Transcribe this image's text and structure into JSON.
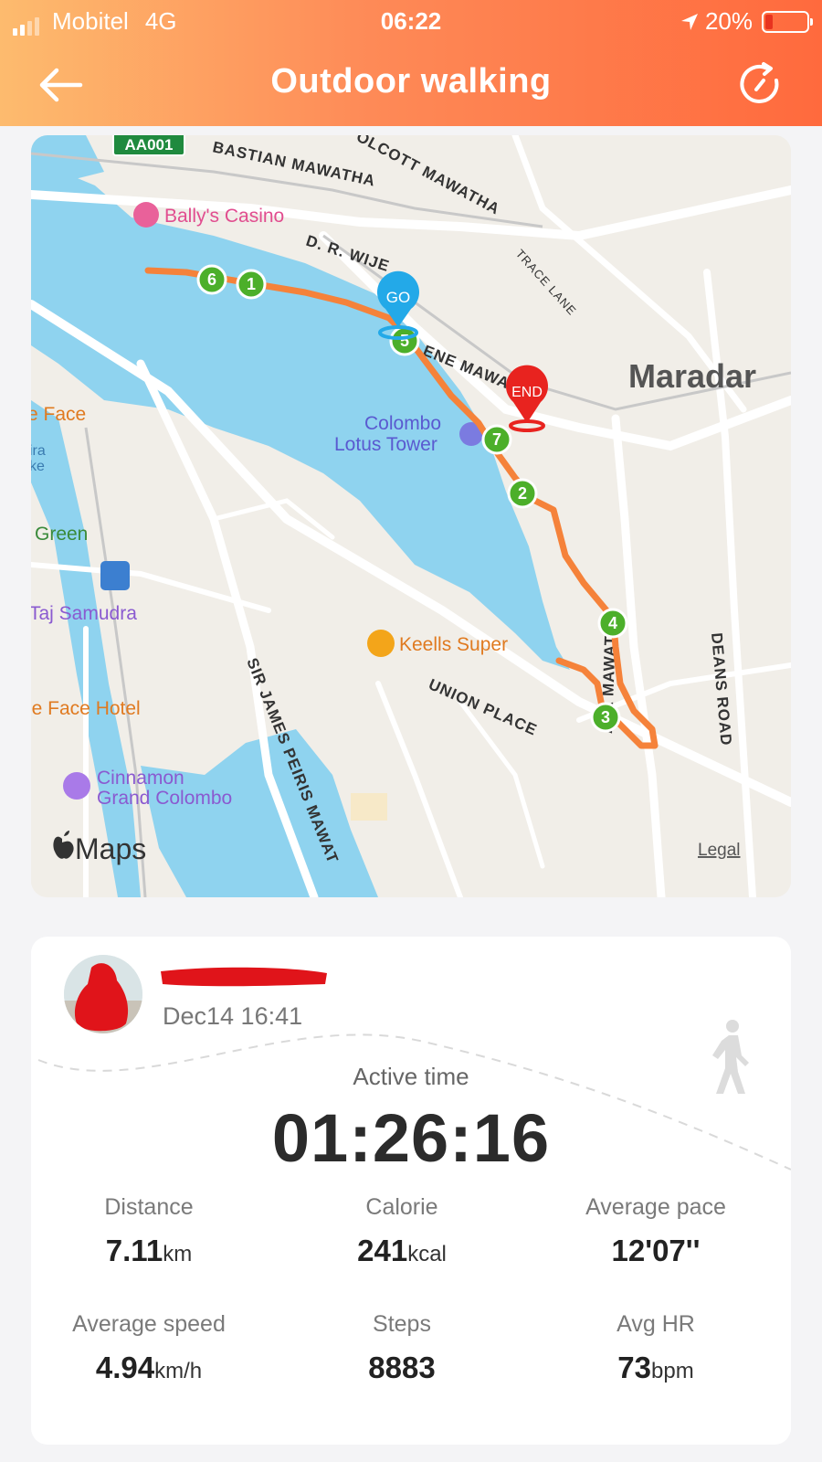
{
  "status_bar": {
    "carrier": "Mobitel",
    "network": "4G",
    "time": "06:22",
    "battery": "20%"
  },
  "header": {
    "title": "Outdoor walking",
    "back_icon": "arrow-left-icon",
    "action_icon": "refresh-icon"
  },
  "map": {
    "streets": [
      "BASTIAN MAWATHA",
      "OLCOTT MAWATHA",
      "D. R. WIJE",
      "TRACE LANE",
      "ENE MAWA",
      "UNION PLACE",
      "SIR JAMES PEIRIS MAWAT",
      "DEANS ROAD",
      "AYA MAWATHA"
    ],
    "highway_shield": "AA001",
    "places": {
      "bally": "Bally's Casino",
      "lotus_1": "Colombo",
      "lotus_2": "Lotus Tower",
      "face": "e Face",
      "ira": "ira",
      "ke": "ke",
      "green": "Green",
      "taj": "Taj Samudra",
      "keells": "Keells Super",
      "face_hotel": "le Face Hotel",
      "cinnamon_1": "Cinnamon",
      "cinnamon_2": "Grand Colombo",
      "maradana": "Maradar"
    },
    "markers": {
      "go": "GO",
      "end": "END",
      "km": [
        "1",
        "2",
        "3",
        "4",
        "5",
        "6",
        "7"
      ]
    },
    "attribution": "Maps",
    "legal": "Legal",
    "colors": {
      "route": "#f5823a",
      "water": "#8fd3ef",
      "km_marker": "#4caf2a",
      "go": "#23a9e8",
      "end": "#e8231f"
    }
  },
  "activity": {
    "date_time": "Dec14 16:41",
    "active_time_label": "Active time",
    "active_time": "01:26:16",
    "stats": [
      {
        "label": "Distance",
        "value": "7.11",
        "unit": "km"
      },
      {
        "label": "Calorie",
        "value": "241",
        "unit": "kcal"
      },
      {
        "label": "Average pace",
        "value": "12'07''",
        "unit": ""
      },
      {
        "label": "Average speed",
        "value": "4.94",
        "unit": "km/h"
      },
      {
        "label": "Steps",
        "value": "8883",
        "unit": ""
      },
      {
        "label": "Avg HR",
        "value": "73",
        "unit": "bpm"
      }
    ]
  }
}
